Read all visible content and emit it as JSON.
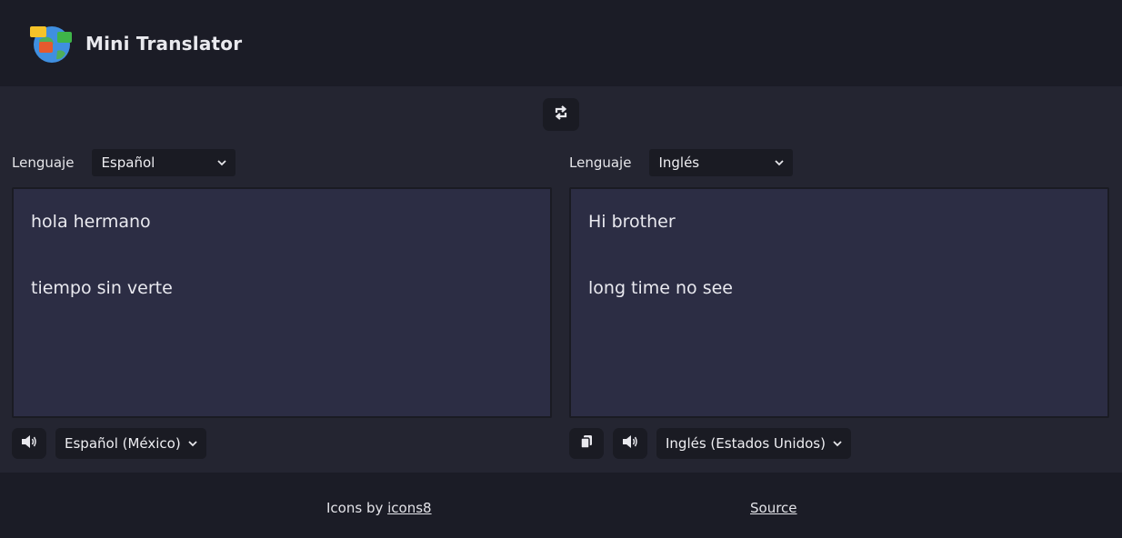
{
  "header": {
    "title": "Mini Translator"
  },
  "source": {
    "language_label": "Lenguaje",
    "language_selected": "Español",
    "text_lines": [
      "hola hermano",
      "tiempo sin verte"
    ],
    "voice_selected": "Español (México)"
  },
  "target": {
    "language_label": "Lenguaje",
    "language_selected": "Inglés",
    "text_lines": [
      "Hi brother",
      "long time no see"
    ],
    "voice_selected": "Inglés (Estados Unidos)"
  },
  "footer": {
    "credit_prefix": "Icons by ",
    "credit_link": "icons8",
    "source_link": "Source"
  },
  "icons": {
    "logo": "globe-chat-logo-icon",
    "swap": "swap-arrows-icon",
    "speaker": "speaker-icon",
    "copy": "copy-icon",
    "chevron": "chevron-down-icon"
  },
  "colors": {
    "background": "#1b1c26",
    "main_background": "#242531",
    "textbox_background": "#2c2d44",
    "control_background": "#1a1b23"
  }
}
